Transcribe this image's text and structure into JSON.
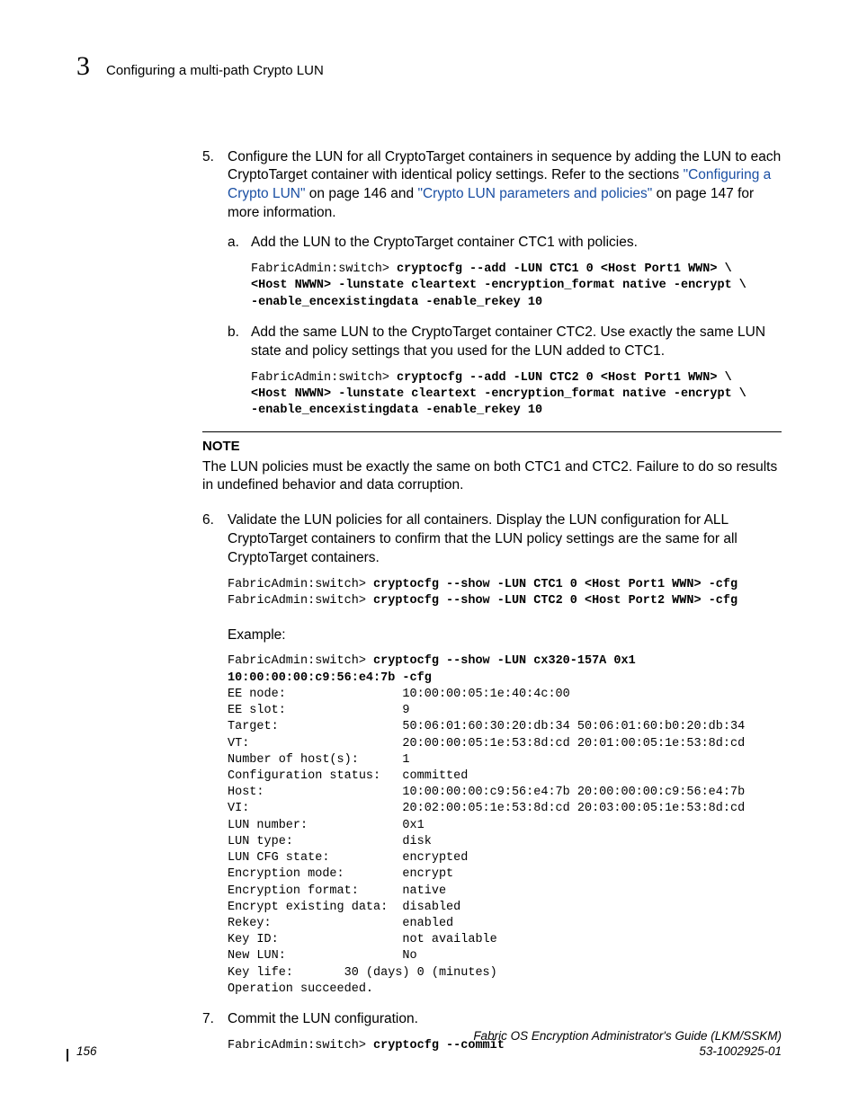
{
  "header": {
    "chapter": "3",
    "running_head": "Configuring a multi-path Crypto LUN"
  },
  "step5": {
    "num": "5.",
    "text_a": "Configure the LUN for all CryptoTarget containers in sequence by adding the LUN to each CryptoTarget container with identical policy settings. Refer to the sections ",
    "link1": "\"Configuring a Crypto LUN\"",
    "text_b": " on page 146 and ",
    "link2": "\"Crypto LUN parameters and policies\"",
    "text_c": " on page 147 for more information.",
    "a": {
      "num": "a.",
      "text": "Add the LUN to the CryptoTarget container CTC1 with policies.",
      "prompt": "FabricAdmin:switch> ",
      "cmd": "cryptocfg --add -LUN CTC1 0 <Host Port1 WWN> \\\n<Host NWWN> -lunstate cleartext -encryption_format native -encrypt \\\n-enable_encexistingdata -enable_rekey 10"
    },
    "b": {
      "num": "b.",
      "text": "Add the same LUN to the CryptoTarget container CTC2. Use exactly the same LUN state and policy settings that you used for the LUN added to CTC1.",
      "prompt": "FabricAdmin:switch> ",
      "cmd": "cryptocfg --add -LUN CTC2 0 <Host Port1 WWN> \\\n<Host NWWN> -lunstate cleartext -encryption_format native -encrypt \\\n-enable_encexistingdata -enable_rekey 10"
    }
  },
  "note": {
    "head": "NOTE",
    "body": "The LUN policies must be exactly the same on both CTC1 and CTC2. Failure to do so results in undefined behavior and data corruption."
  },
  "step6": {
    "num": "6.",
    "text": "Validate the LUN policies for all containers. Display the LUN configuration for ALL CryptoTarget containers to confirm that the LUN policy settings are the same for all CryptoTarget containers.",
    "prompt1": "FabricAdmin:switch> ",
    "cmd1": "cryptocfg --show -LUN CTC1 0 <Host Port1 WWN> -cfg",
    "prompt2": "FabricAdmin:switch> ",
    "cmd2": "cryptocfg --show -LUN CTC2 0 <Host Port2 WWN> -cfg",
    "example_label": "Example:",
    "ex_prompt": "FabricAdmin:switch> ",
    "ex_cmd": "cryptocfg --show -LUN cx320-157A 0x1 \n10:00:00:00:c9:56:e4:7b -cfg",
    "ex_output": "EE node:                10:00:00:05:1e:40:4c:00\nEE slot:                9\nTarget:                 50:06:01:60:30:20:db:34 50:06:01:60:b0:20:db:34\nVT:                     20:00:00:05:1e:53:8d:cd 20:01:00:05:1e:53:8d:cd\nNumber of host(s):      1\nConfiguration status:   committed\nHost:                   10:00:00:00:c9:56:e4:7b 20:00:00:00:c9:56:e4:7b\nVI:                     20:02:00:05:1e:53:8d:cd 20:03:00:05:1e:53:8d:cd\nLUN number:             0x1\nLUN type:               disk\nLUN CFG state:          encrypted\nEncryption mode:        encrypt\nEncryption format:      native\nEncrypt existing data:  disabled\nRekey:                  enabled\nKey ID:                 not available\nNew LUN:                No\nKey life:       30 (days) 0 (minutes)\nOperation succeeded."
  },
  "step7": {
    "num": "7.",
    "text": "Commit the LUN configuration.",
    "prompt": "FabricAdmin:switch> ",
    "cmd": "cryptocfg --commit"
  },
  "footer": {
    "page": "156",
    "title": "Fabric OS Encryption Administrator's Guide  (LKM/SSKM)",
    "docnum": "53-1002925-01"
  }
}
